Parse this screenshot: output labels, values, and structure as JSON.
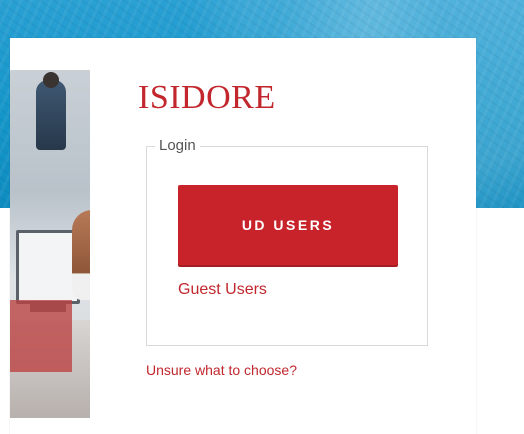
{
  "app": {
    "title": "ISIDORE"
  },
  "login": {
    "legend": "Login",
    "ud_button_label": "UD USERS",
    "guest_link": "Guest Users",
    "unsure_link": "Unsure what to choose?"
  },
  "colors": {
    "brand_red": "#c1272d",
    "button_red": "#c8232a",
    "banner_blue": "#1596c9"
  }
}
